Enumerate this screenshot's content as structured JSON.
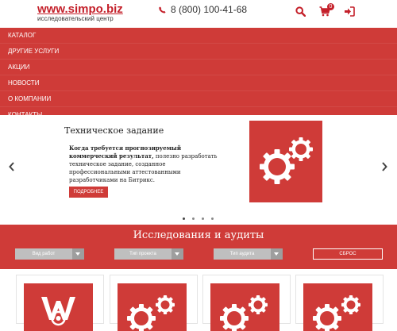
{
  "header": {
    "logo_title": "www.simpo.biz",
    "logo_subtitle": "исследовательский центр",
    "phone": "8 (800) 100-41-68",
    "cart_count": "0",
    "icons": [
      "phone-icon",
      "search-icon",
      "cart-icon",
      "login-icon"
    ]
  },
  "nav": {
    "items": [
      {
        "label": "КАТАЛОГ"
      },
      {
        "label": "ДРУГИЕ УСЛУГИ"
      },
      {
        "label": "АКЦИИ"
      },
      {
        "label": "НОВОСТИ"
      },
      {
        "label": "О КОМПАНИИ"
      },
      {
        "label": "КОНТАКТЫ"
      }
    ]
  },
  "slider": {
    "title": "Техническое задание",
    "text_bold": "Когда требуется прогнозируемый коммерческий результат,",
    "text_rest": " полезно разработать техническое задание, созданное профессиональными аттестованными разработчиками на Битрикс.",
    "button_label": "ПОДРОБНЕЕ",
    "image_icon": "gears-icon",
    "slide_count": 4,
    "active_slide": 1
  },
  "research": {
    "title": "Исследования и аудиты",
    "filters": [
      {
        "label": "Вид работ"
      },
      {
        "label": "Тип проекта"
      },
      {
        "label": "Тип аудита"
      }
    ],
    "reset_label": "СБРОС"
  },
  "cards": [
    {
      "icon": "brand-logo-icon"
    },
    {
      "icon": "gears-icon"
    },
    {
      "icon": "gears-icon"
    },
    {
      "icon": "gears-icon"
    }
  ],
  "colors": {
    "brand_red": "#cf3b38",
    "logo_red": "#c4202a",
    "filter_gray": "#bfbfbf"
  }
}
